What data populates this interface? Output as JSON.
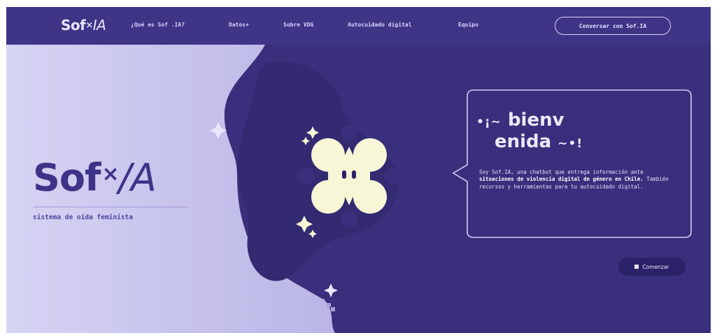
{
  "nav": {
    "logo_main": "Sof",
    "logo_x": "×",
    "logo_ia": "IA",
    "links": [
      "¿Qué es Sof .IA?",
      "Datos+",
      "Sobre VDG",
      "Autocuidado digital",
      "Equipo"
    ],
    "cta_label": "Conversar con Sof.IA"
  },
  "hero": {
    "brand_main": "Sof",
    "brand_x": "×",
    "brand_ia": "/A",
    "tagline": "sistema de oída feminista"
  },
  "bubble": {
    "welcome_deco_left": "•¡~",
    "welcome_line1": "bienv",
    "welcome_line2": "enida",
    "welcome_deco_right": "~•!",
    "desc_1": "Soy Sof.IA, una chatbot que entrega información ante ",
    "desc_bold": "situaciones de violencia digital de género en Chile.",
    "desc_2": " También  recursos y herramientas para tu autocuidado digital.",
    "start_label": "Comenzar"
  },
  "colors": {
    "background": "#3a2f7c",
    "nav": "#3f3586",
    "lavender": "#c9c6ee",
    "mascot": "#f7f6d6",
    "brand": "#3d3388"
  },
  "icons": [
    "sparkle-icon",
    "mascot-cross-icon",
    "square-bullet-icon"
  ]
}
